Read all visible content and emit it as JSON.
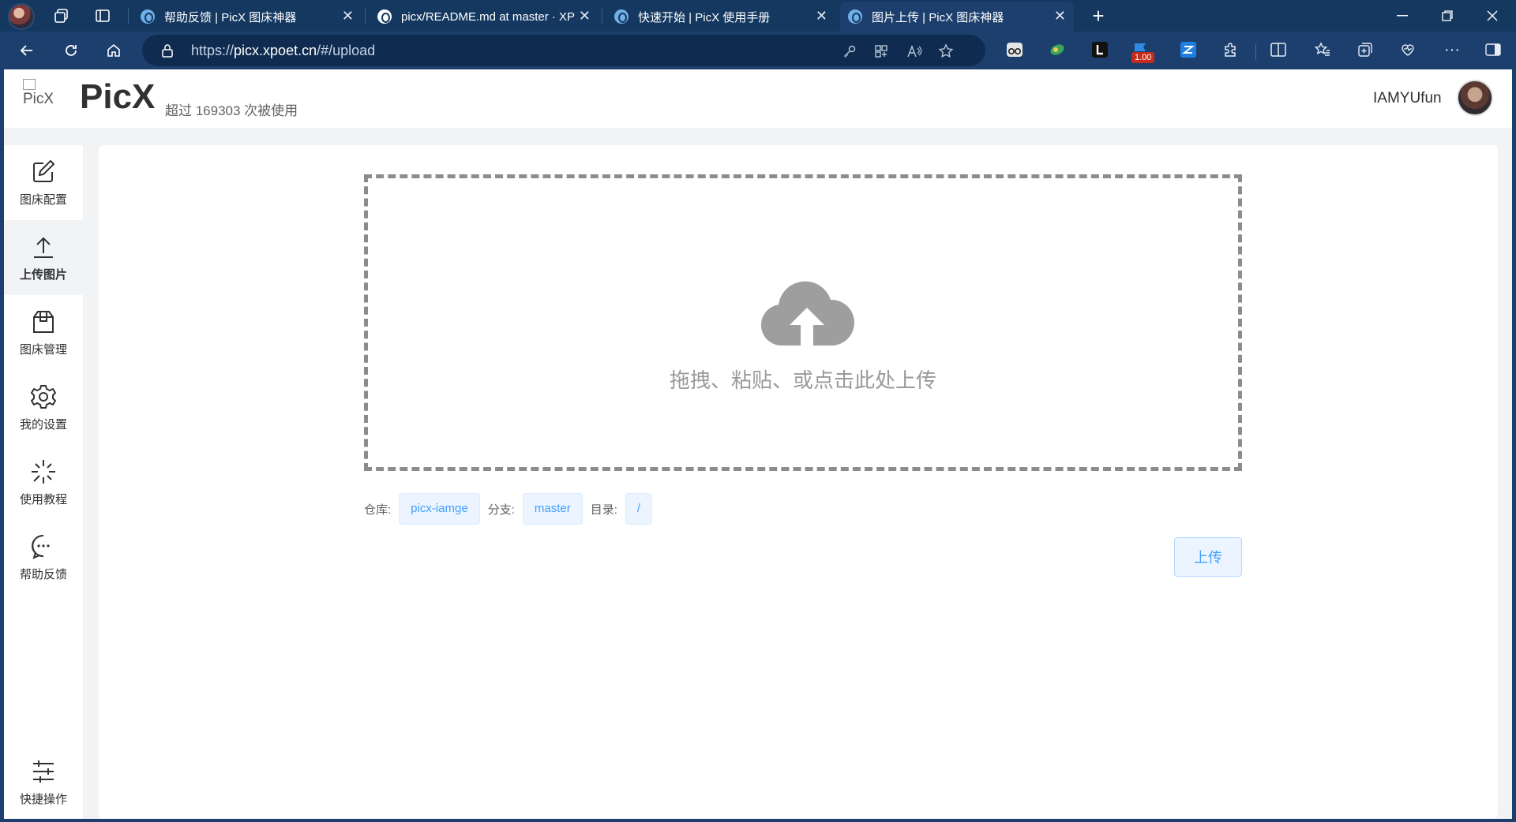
{
  "browser": {
    "tabs": [
      {
        "title": "帮助反馈 | PicX 图床神器",
        "favicon": "picx-icon",
        "active": false
      },
      {
        "title": "picx/README.md at master · XPo",
        "favicon": "github-icon",
        "active": false
      },
      {
        "title": "快速开始 | PicX 使用手册",
        "favicon": "picx-icon",
        "active": false
      },
      {
        "title": "图片上传 | PicX 图床神器",
        "favicon": "picx-icon",
        "active": true
      }
    ],
    "url_prefix": "https://",
    "url_domain": "picx.xpoet.cn",
    "url_path": "/#/upload",
    "extension_badge": "1.00"
  },
  "header": {
    "logo_alt": "PicX",
    "brand": "PicX",
    "usage_text": "超过 169303 次被使用",
    "username": "IAMYUfun"
  },
  "sidebar": {
    "items": [
      {
        "label": "图床配置",
        "icon": "edit-icon"
      },
      {
        "label": "上传图片",
        "icon": "upload-icon",
        "active": true
      },
      {
        "label": "图床管理",
        "icon": "package-icon"
      },
      {
        "label": "我的设置",
        "icon": "gear-icon"
      },
      {
        "label": "使用教程",
        "icon": "sparkle-icon"
      },
      {
        "label": "帮助反馈",
        "icon": "chat-icon"
      }
    ],
    "bottom_item": {
      "label": "快捷操作",
      "icon": "sliders-icon"
    }
  },
  "upload": {
    "drop_text": "拖拽、粘贴、或点击此处上传",
    "repo_label": "仓库:",
    "repo_value": "picx-iamge",
    "branch_label": "分支:",
    "branch_value": "master",
    "dir_label": "目录:",
    "dir_value": "/",
    "button_label": "上传"
  },
  "colors": {
    "accent": "#409eff",
    "tag_bg": "#ecf5ff",
    "chrome_dark": "#153861",
    "chrome": "#1d3f6e"
  }
}
